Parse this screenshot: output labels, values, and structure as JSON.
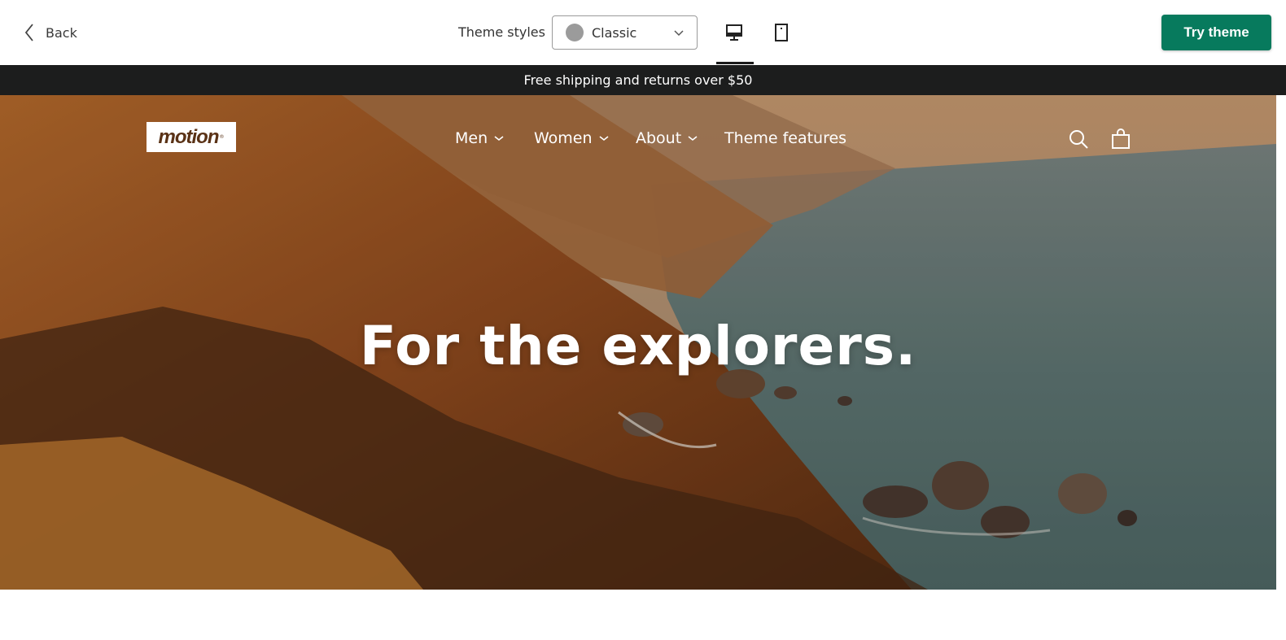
{
  "topbar": {
    "back_label": "Back",
    "theme_styles_label": "Theme styles",
    "selected_style": "Classic",
    "selected_style_color": "#9b9b9b",
    "try_button_label": "Try theme",
    "try_button_color": "#077a5d",
    "active_device": "desktop"
  },
  "announcement": {
    "text": "Free shipping and returns over $50"
  },
  "store": {
    "logo_text": "motion",
    "nav": {
      "men": "Men",
      "women": "Women",
      "about": "About",
      "features": "Theme features"
    },
    "icons": [
      "search-icon",
      "cart-icon"
    ],
    "hero_headline": "For the explorers."
  }
}
